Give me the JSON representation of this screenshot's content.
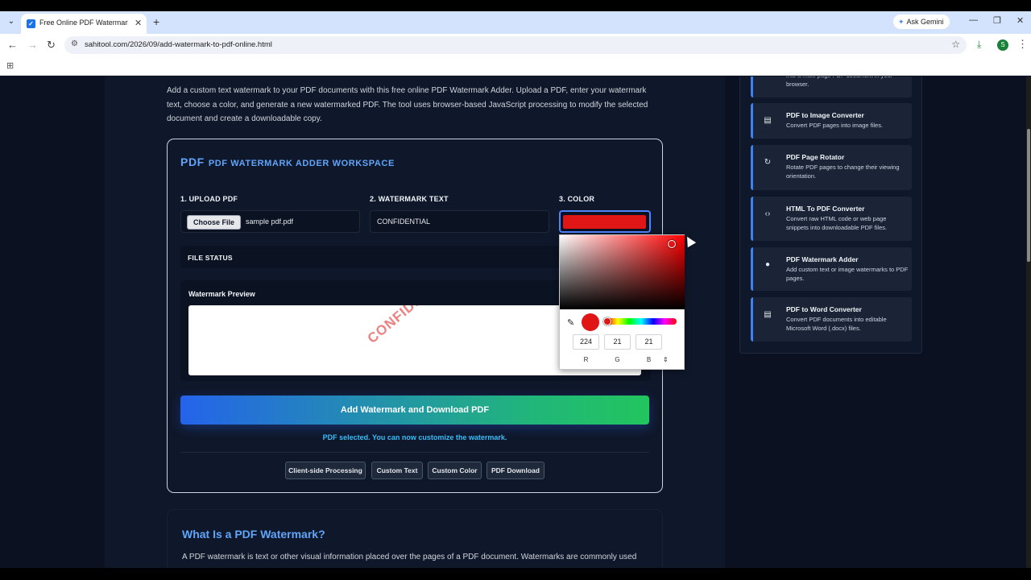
{
  "browser": {
    "tab_title": "Free Online PDF Watermark Ad",
    "url": "sahitool.com/2026/09/add-watermark-to-pdf-online.html",
    "ask_gemini": "Ask Gemini",
    "profile_initial": "S"
  },
  "intro": "Add a custom text watermark to your PDF documents with this free online PDF Watermark Adder. Upload a PDF, enter your watermark text, choose a color, and generate a new watermarked PDF. The tool uses browser-based JavaScript processing to modify the selected document and create a downloadable copy.",
  "workspace": {
    "tag": "PDF",
    "title": "PDF WATERMARK ADDER WORKSPACE",
    "upload_label": "1. UPLOAD PDF",
    "choose_file": "Choose File",
    "file_name": "sample pdf.pdf",
    "text_label": "2. WATERMARK TEXT",
    "text_value": "CONFIDENTIAL",
    "color_label": "3. COLOR",
    "color_value": "#e01515",
    "file_status": "FILE STATUS",
    "preview_label": "Watermark Preview",
    "preview_text": "CONFIDENTIAL",
    "action": "Add Watermark and Download PDF",
    "status_message": "PDF selected. You can now customize the watermark.",
    "chips": [
      "Client-side Processing",
      "Custom Text",
      "Custom Color",
      "PDF Download"
    ]
  },
  "color_picker": {
    "r": "224",
    "g": "21",
    "b": "21",
    "r_label": "R",
    "g_label": "G",
    "b_label": "B",
    "hue_fraction": 0
  },
  "section": {
    "title": "What Is a PDF Watermark?",
    "text": "A PDF watermark is text or other visual information placed over the pages of a PDF document. Watermarks are commonly used"
  },
  "sidebar": {
    "partial_desc": "into a multi-page PDF document in your browser.",
    "tools": [
      {
        "icon": "image-file-icon",
        "name": "PDF to Image Converter",
        "desc": "Convert PDF pages into image files."
      },
      {
        "icon": "rotate-icon",
        "name": "PDF Page Rotator",
        "desc": "Rotate PDF pages to change their viewing orientation."
      },
      {
        "icon": "code-icon",
        "name": "HTML To PDF Converter",
        "desc": "Convert raw HTML code or web page snippets into downloadable PDF files."
      },
      {
        "icon": "dot-icon",
        "name": "PDF Watermark Adder",
        "desc": "Add custom text or image watermarks to PDF pages."
      },
      {
        "icon": "document-icon",
        "name": "PDF to Word Converter",
        "desc": "Convert PDF documents into editable Microsoft Word (.docx) files."
      }
    ]
  }
}
